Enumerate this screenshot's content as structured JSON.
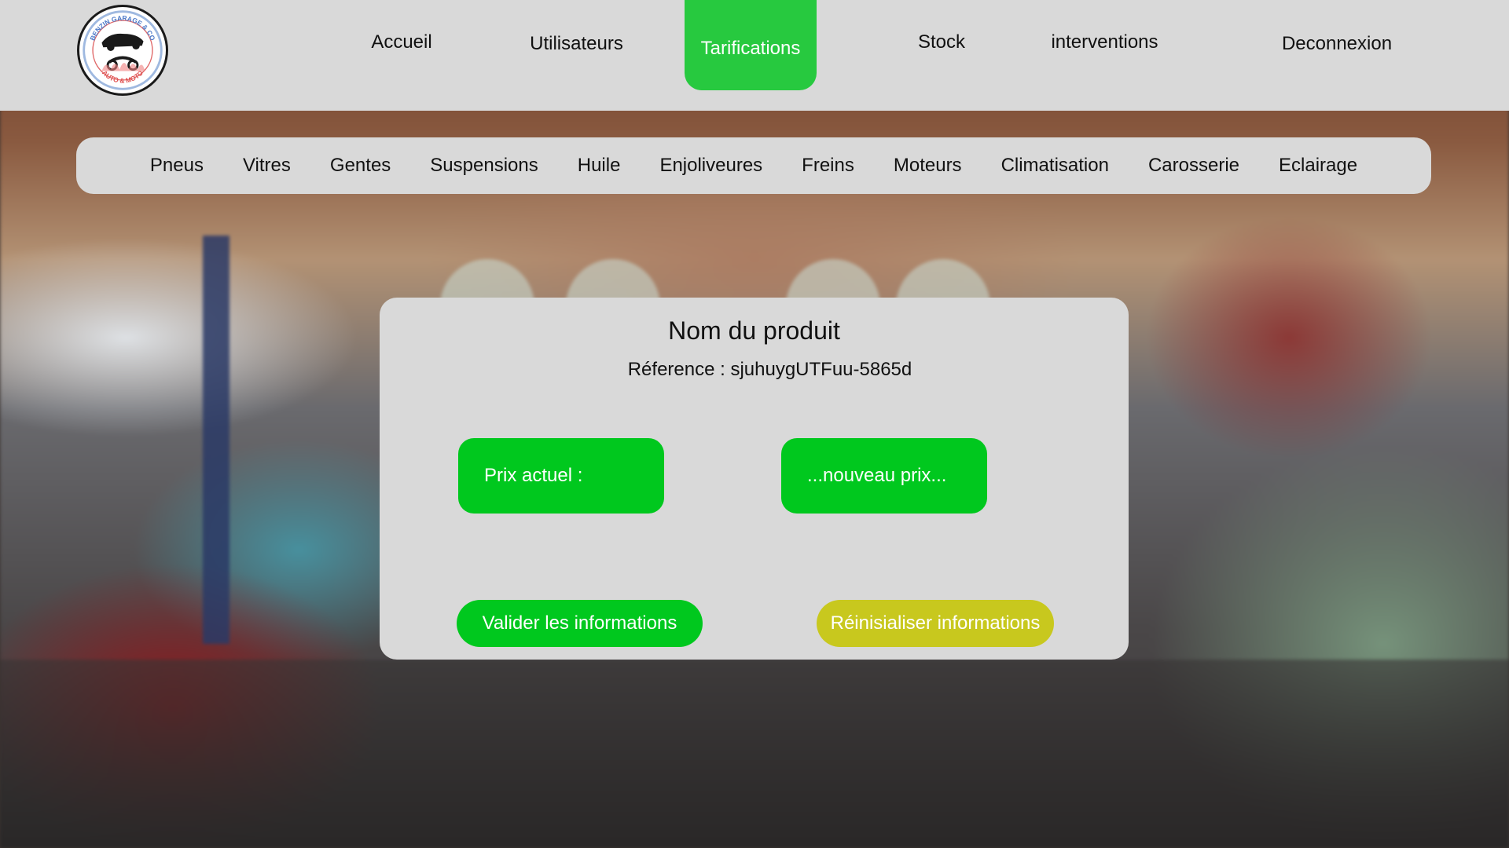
{
  "colors": {
    "bar_background": "#d9d9d9",
    "active_tab": "#27c93f",
    "primary_green": "#00c81e",
    "reset_yellow": "#c8c81e",
    "text": "#111111"
  },
  "logo": {
    "icon": "garage-logo-car-moto",
    "ring_text_top": "BENZIN GARAGE & CO",
    "ring_text_bottom": "AUTO & MOTO"
  },
  "nav": {
    "items": [
      {
        "label": "Accueil",
        "active": false
      },
      {
        "label": "Utilisateurs",
        "active": false
      },
      {
        "label": "Tarifications",
        "active": true
      },
      {
        "label": "Stock",
        "active": false
      },
      {
        "label": "interventions",
        "active": false
      },
      {
        "label": "Deconnexion",
        "active": false
      }
    ]
  },
  "categories": [
    "Pneus",
    "Vitres",
    "Gentes",
    "Suspensions",
    "Huile",
    "Enjoliveures",
    "Freins",
    "Moteurs",
    "Climatisation",
    "Carosserie",
    "Eclairage"
  ],
  "product": {
    "title": "Nom du produit",
    "reference": "Réference : sjuhuygUTFuu-5865d",
    "current_price_label": "Prix actuel :",
    "new_price_placeholder": "...nouveau prix..."
  },
  "actions": {
    "validate_label": "Valider les informations",
    "reset_label": "Réinisialiser informations"
  }
}
